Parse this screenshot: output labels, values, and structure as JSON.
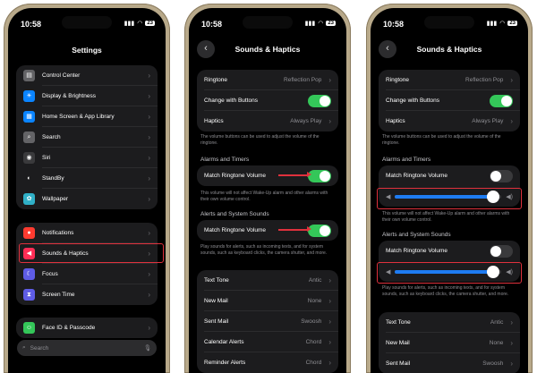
{
  "status": {
    "time": "10:58",
    "battery": "23"
  },
  "phone1": {
    "title": "Settings",
    "group1": [
      {
        "label": "Control Center",
        "icon": "control-center-icon",
        "color": "#636366",
        "glyph": "▤"
      },
      {
        "label": "Display & Brightness",
        "icon": "brightness-icon",
        "color": "#0a84ff",
        "glyph": "☀"
      },
      {
        "label": "Home Screen & App Library",
        "icon": "home-screen-icon",
        "color": "#0a84ff",
        "glyph": "▦"
      },
      {
        "label": "Search",
        "icon": "search-icon",
        "color": "#636366",
        "glyph": "⌕"
      },
      {
        "label": "Siri",
        "icon": "siri-icon",
        "color": "#3a3a3c",
        "glyph": "◉"
      },
      {
        "label": "StandBy",
        "icon": "standby-icon",
        "color": "#1c1c1e",
        "glyph": "◐"
      },
      {
        "label": "Wallpaper",
        "icon": "wallpaper-icon",
        "color": "#30b0c7",
        "glyph": "✿"
      }
    ],
    "group2": [
      {
        "label": "Notifications",
        "icon": "notifications-icon",
        "color": "#ff3b30",
        "glyph": "●"
      },
      {
        "label": "Sounds & Haptics",
        "icon": "speaker-icon",
        "color": "#ff2d55",
        "glyph": "◀"
      },
      {
        "label": "Focus",
        "icon": "moon-icon",
        "color": "#5e5ce6",
        "glyph": "☾"
      },
      {
        "label": "Screen Time",
        "icon": "hourglass-icon",
        "color": "#5e5ce6",
        "glyph": "⧗"
      }
    ],
    "group3": [
      {
        "label": "Face ID & Passcode",
        "icon": "face-id-icon",
        "color": "#34c759",
        "glyph": "☺"
      }
    ],
    "search_placeholder": "Search"
  },
  "phone2": {
    "title": "Sounds & Haptics",
    "group1": [
      {
        "label": "Ringtone",
        "value": "Reflection Pop"
      },
      {
        "label": "Change with Buttons",
        "toggle": true
      },
      {
        "label": "Haptics",
        "value": "Always Play"
      }
    ],
    "note1": "The volume buttons can be used to adjust the volume of the ringtone.",
    "alarms_header": "Alarms and Timers",
    "match1_label": "Match Ringtone Volume",
    "match1_on": true,
    "note2": "This volume will not affect Wake-Up alarm and other alarms with their own volume control.",
    "alerts_header": "Alerts and System Sounds",
    "match2_label": "Match Ringtone Volume",
    "match2_on": true,
    "note3": "Play sounds for alerts, such as incoming texts, and for system sounds, such as keyboard clicks, the camera shutter, and more.",
    "group4": [
      {
        "label": "Text Tone",
        "value": "Antic"
      },
      {
        "label": "New Mail",
        "value": "None"
      },
      {
        "label": "Sent Mail",
        "value": "Swoosh"
      },
      {
        "label": "Calendar Alerts",
        "value": "Chord"
      },
      {
        "label": "Reminder Alerts",
        "value": "Chord"
      }
    ]
  },
  "phone3": {
    "title": "Sounds & Haptics",
    "group1": [
      {
        "label": "Ringtone",
        "value": "Reflection Pop"
      },
      {
        "label": "Change with Buttons",
        "toggle": true
      },
      {
        "label": "Haptics",
        "value": "Always Play"
      }
    ],
    "note1": "The volume buttons can be used to adjust the volume of the ringtone.",
    "alarms_header": "Alarms and Timers",
    "match1_label": "Match Ringtone Volume",
    "match1_on": false,
    "slider1_level": 0.92,
    "note2": "This volume will not affect Wake-Up alarm and other alarms with their own volume control.",
    "alerts_header": "Alerts and System Sounds",
    "match2_label": "Match Ringtone Volume",
    "match2_on": false,
    "slider2_level": 0.92,
    "note3": "Play sounds for alerts, such as incoming texts, and for system sounds, such as keyboard clicks, the camera shutter, and more.",
    "group4": [
      {
        "label": "Text Tone",
        "value": "Antic"
      },
      {
        "label": "New Mail",
        "value": "None"
      },
      {
        "label": "Sent Mail",
        "value": "Swoosh"
      }
    ]
  },
  "colors": {
    "accent": "#34c759",
    "highlight": "#e0313d",
    "slider": "#1e7cf2"
  }
}
